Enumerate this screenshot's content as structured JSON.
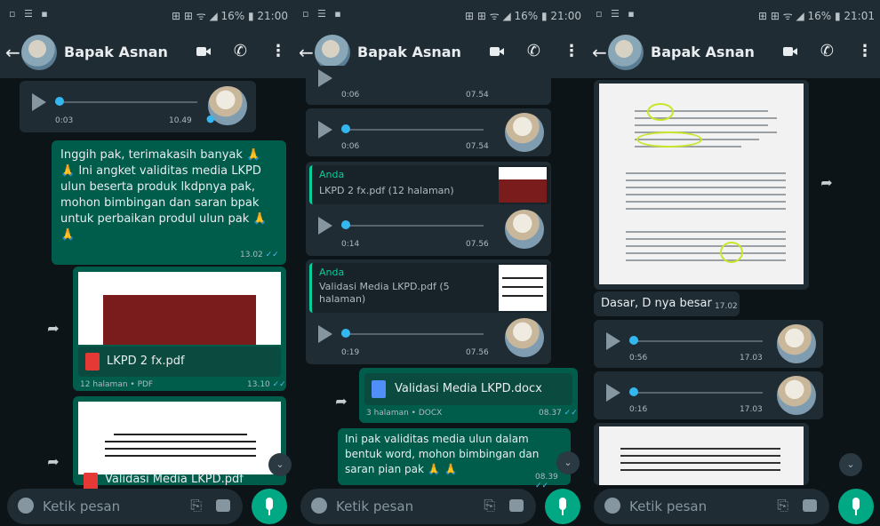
{
  "contact_name": "Bapak Asnan",
  "input_placeholder": "Ketik pesan",
  "colors": {
    "header": "#1f2c33",
    "outgoing": "#005c4b",
    "incoming": "#1f2c33",
    "accent": "#00a884",
    "tick": "#53bdeb"
  },
  "icons": [
    "back-arrow-icon",
    "video-call-icon",
    "phone-icon",
    "more-options-icon",
    "play-icon",
    "forward-icon",
    "scroll-down-icon",
    "emoji-icon",
    "attach-icon",
    "camera-icon",
    "mic-icon"
  ],
  "panels": [
    {
      "status": {
        "left": "▫ ☰ ▪",
        "right": "⊞ ⊞ ᯤ ◢ 16% ▮ 21:00"
      },
      "audio1": {
        "duration": "0:03",
        "time": "10.49"
      },
      "msg1": {
        "text": "Inggih pak, terimakasih banyak 🙏 🙏 Ini angket validitas media LKPD ulun beserta produk lkdpnya pak, mohon bimbingan dan saran bpak untuk perbaikan produl ulun pak 🙏 🙏",
        "time": "13.02"
      },
      "file1": {
        "name": "LKPD 2 fx.pdf",
        "meta": "12 halaman • PDF",
        "time": "13.10"
      },
      "file2": {
        "name": "Validasi Media LKPD.pdf"
      }
    },
    {
      "status": {
        "left": "▫ ☰ ▪",
        "right": "⊞ ⊞ ᯤ ◢ 16% ▮ 21:00"
      },
      "audio0": {
        "duration": "0:06",
        "time": "07.54"
      },
      "audio1": {
        "duration": "0:06",
        "time": "07.54"
      },
      "quote1": {
        "author": "Anda",
        "file": "LKPD 2 fx.pdf (12 halaman)"
      },
      "audio2": {
        "duration": "0:14",
        "time": "07.56"
      },
      "quote2": {
        "author": "Anda",
        "file": "Validasi Media LKPD.pdf (5 halaman)"
      },
      "audio3": {
        "duration": "0:19",
        "time": "07.56"
      },
      "doc": {
        "name": "Validasi Media LKPD.docx",
        "meta": "3 halaman • DOCX",
        "time": "08.37"
      },
      "msg": {
        "text": "Ini pak validitas media ulun dalam bentuk word, mohon bimbingan dan saran pian pak 🙏 🙏",
        "time": "08.39"
      }
    },
    {
      "status": {
        "left": "▫ ☰ ▪",
        "right": "⊞ ⊞ ᯤ ◢ 16% ▮ 21:01"
      },
      "note": {
        "text": "Dasar, D nya besar",
        "time": "17.02"
      },
      "audio1": {
        "duration": "0:56",
        "time": "17.03"
      },
      "audio2": {
        "duration": "0:16",
        "time": "17.03"
      }
    }
  ]
}
